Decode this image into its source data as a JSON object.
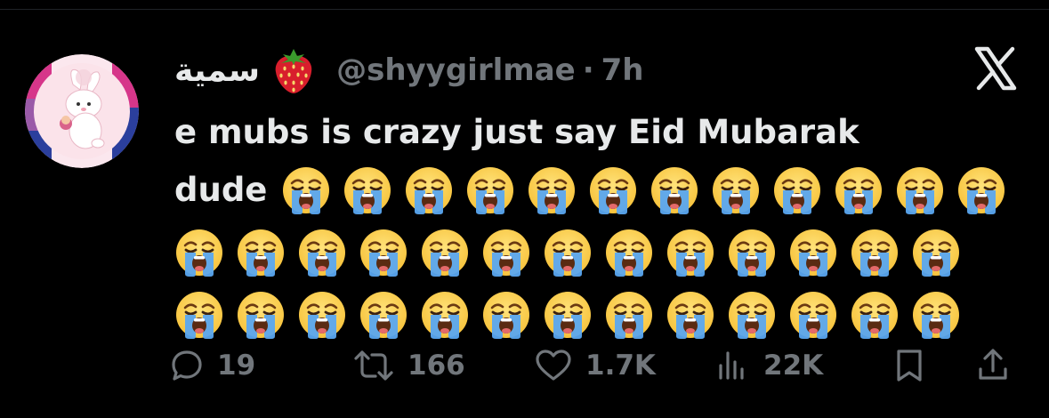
{
  "user": {
    "display_name": "سمية",
    "name_emoji": "strawberry-icon",
    "handle": "@shyygirlmae",
    "separator": "·",
    "time": "7h"
  },
  "tweet": {
    "line1": "e mubs is crazy just say Eid Mubarak",
    "line2_word": "dude",
    "emoji": "loudly-crying-face-icon",
    "emoji_counts": [
      12,
      13,
      13
    ]
  },
  "actions": {
    "replies": "19",
    "retweets": "166",
    "likes": "1.7K",
    "views": "22K"
  },
  "colors": {
    "background": "#000000",
    "text": "#e7e9ea",
    "muted": "#71767b",
    "emoji_yellow": "#f7c33c",
    "tear_blue": "#5aa6f0"
  }
}
